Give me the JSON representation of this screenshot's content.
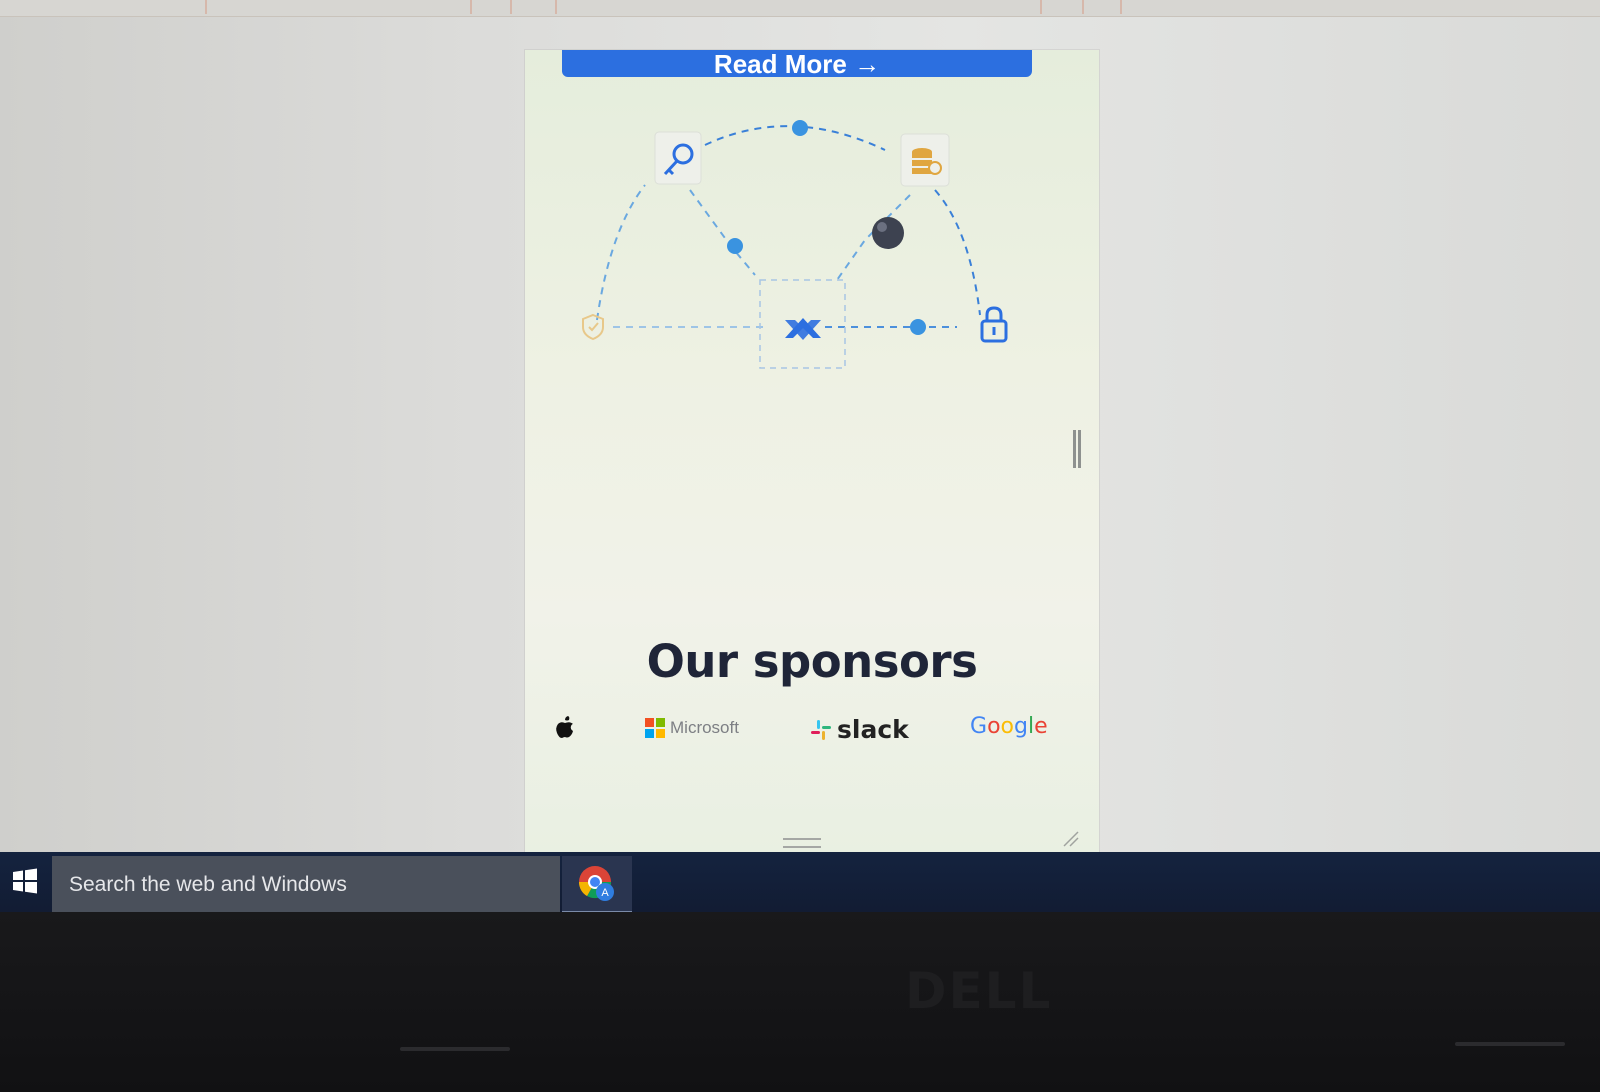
{
  "window": {
    "read_more_label": "Read More →"
  },
  "sponsors": {
    "title": "Our sponsors",
    "items": [
      {
        "name": "Apple",
        "icon": "apple-icon"
      },
      {
        "name": "Microsoft",
        "label": "Microsoft",
        "icon": "microsoft-icon"
      },
      {
        "name": "Slack",
        "label": "slack",
        "icon": "slack-icon"
      },
      {
        "name": "Google",
        "label": "Google"
      }
    ]
  },
  "illustration_icons": [
    "key-icon",
    "database-icon",
    "shield-icon",
    "logo-icon",
    "lock-icon"
  ],
  "taskbar": {
    "search_placeholder": "Search the web and Windows",
    "pinned_app_icon": "chrome-icon"
  },
  "bezel": {
    "brand": "DELL"
  },
  "colors": {
    "accent_blue": "#2c6fe0",
    "dot_blue": "#3a93e0",
    "taskbar": "#14233f",
    "title_text": "#1f2538"
  }
}
